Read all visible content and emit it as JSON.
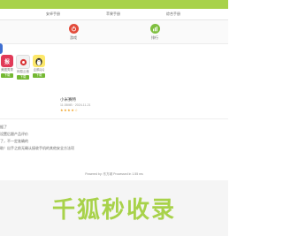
{
  "tabs": [
    "安卓手册",
    "苹果手册",
    "综合手册"
  ],
  "tools": [
    {
      "label": "游戏",
      "icon": "power-icon",
      "color": "#e24b3b"
    },
    {
      "label": "排行",
      "icon": "chart-icon",
      "color": "#7fbf3f"
    }
  ],
  "apps": [
    {
      "name": "美图秀秀",
      "icon_text": "报",
      "button": "下载"
    },
    {
      "name": "网易云音",
      "icon_text": "",
      "button": "下载"
    },
    {
      "name": "企鹅QQ",
      "icon_text": "",
      "button": "下载"
    }
  ],
  "article": {
    "title": "小米赛特",
    "meta": "11.05MB · 2024-11-21",
    "rating": "★★★★☆"
  },
  "notes": [
    "据了",
    "设置后跟产品评价",
    "了，不一定准确的",
    "助！出手之前无确认接收手机的其他安全方法项"
  ],
  "footer": "Powered by: 东方城  Processed in 1.55 ms",
  "watermark": "千狐秒收录",
  "accent": "#a8d24a"
}
